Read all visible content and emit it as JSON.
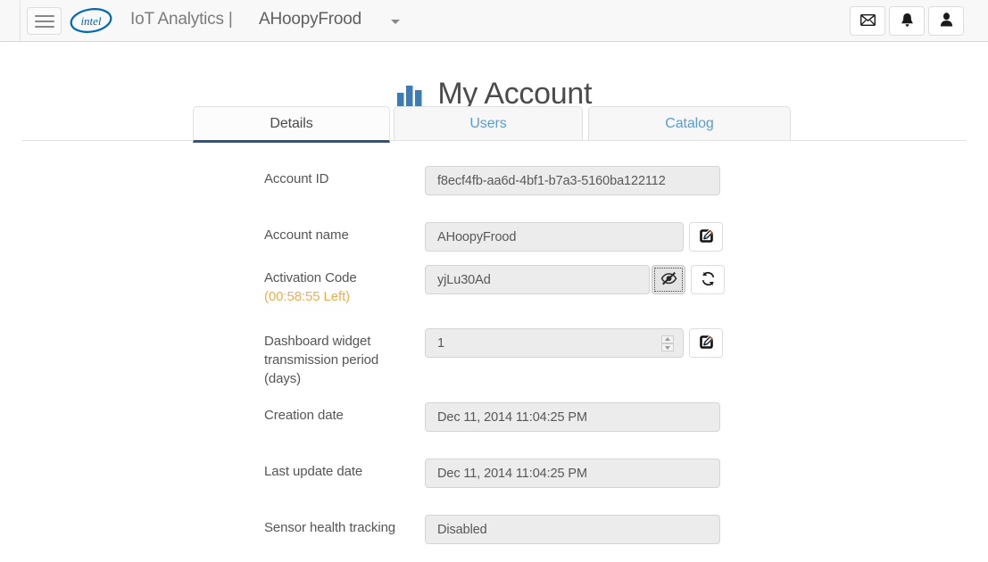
{
  "header": {
    "menu_label": "Menu",
    "logo_text": "intel",
    "brand": "IoT Analytics |",
    "account": "AHoopyFrood",
    "icons": {
      "menu": "hamburger-menu-icon",
      "logo": "intel-logo-icon",
      "caret": "chevron-down-icon",
      "mail": "envelope-icon",
      "bell": "bell-icon",
      "user": "user-icon"
    }
  },
  "page": {
    "title": "My Account",
    "title_icon": "bar-chart-icon"
  },
  "tabs": [
    {
      "label": "Details",
      "active": true
    },
    {
      "label": "Users",
      "active": false
    },
    {
      "label": "Catalog",
      "active": false
    }
  ],
  "fields": {
    "account_id": {
      "label": "Account ID",
      "value": "f8ecf4fb-aa6d-4bf1-b7a3-5160ba122112"
    },
    "account_name": {
      "label": "Account name",
      "value": "AHoopyFrood",
      "edit_icon": "pencil-square-icon"
    },
    "activation_code": {
      "label": "Activation Code",
      "timer": "(00:58:55 Left)",
      "value": "yjLu30Ad",
      "reveal_icon": "eye-slash-icon",
      "refresh_icon": "refresh-icon"
    },
    "widget_period": {
      "label": "Dashboard widget transmission period (days)",
      "value": "1",
      "edit_icon": "pencil-square-icon",
      "spinner_icon": "number-spinner-icon"
    },
    "creation_date": {
      "label": "Creation date",
      "value": "Dec 11, 2014 11:04:25 PM"
    },
    "last_update_date": {
      "label": "Last update date",
      "value": "Dec 11, 2014 11:04:25 PM"
    },
    "sensor_health": {
      "label": "Sensor health tracking",
      "value": "Disabled"
    }
  },
  "colors": {
    "link_blue": "#5b9bd5",
    "active_tab_underline": "#2b5580",
    "timer_orange": "#f0ad4e",
    "intel_blue": "#0068b5",
    "title_gray": "#4b4b4b"
  }
}
